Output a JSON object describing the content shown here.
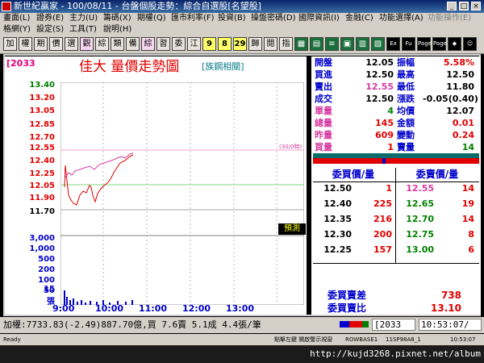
{
  "window": {
    "title": "新世紀贏家 - 100/08/11 - 台盤個股走勢：綜合自選股[名望股]"
  },
  "menu_row1": [
    "畫面(L)",
    "證券(E)",
    "主力(U)",
    "籌碼(X)",
    "期權(Q)",
    "匯市利率(F)",
    "投資(B)",
    "操盤密碼(D)",
    "國際資訊(I)",
    "金融(C)",
    "功能選擇(A)",
    "功能操作(E)"
  ],
  "menu_row2": [
    "格網(Y)",
    "設定(S)",
    "工具(T)",
    "說明(H)"
  ],
  "toolbar": [
    "加",
    "權",
    "期",
    "價",
    "選",
    "觀",
    "綜",
    "類",
    "備",
    "綜",
    "習",
    "委",
    "江",
    "9",
    "8",
    "29",
    "歸",
    "閱",
    "指",
    "",
    "",
    "",
    "",
    "Ex",
    "Fu",
    "Page",
    "Page"
  ],
  "stock": {
    "code": "[2033",
    "name": "佳大  量價走勢圖",
    "related": "[族鋼相關]"
  },
  "price_axis": [
    "13.40",
    "13.20",
    "13.05",
    "12.85",
    "12.70",
    "12.55",
    "12.40",
    "12.25",
    "12.05",
    "11.90",
    "11.70"
  ],
  "volume_axis": [
    "3,000",
    "1,000",
    "500",
    "200",
    "100",
    "50",
    "25",
    "15",
    "張"
  ],
  "time_axis": [
    "9:00",
    "10:00",
    "11:00",
    "12:00",
    "13:00"
  ],
  "annotation": "(30/0時)",
  "prediction_label": "預測",
  "quote": [
    {
      "l1": "開盤",
      "v1": "12.05",
      "l2": "振幅",
      "v2": "5.58%"
    },
    {
      "l1": "買進",
      "v1": "12.50",
      "l2": "最高",
      "v2": "12.50"
    },
    {
      "l1": "賣出",
      "v1": "12.55",
      "l2": "最低",
      "v2": "11.80"
    },
    {
      "l1": "成交",
      "v1": "12.50",
      "l2": "漲跌",
      "v2": "-0.05(0.40)"
    },
    {
      "l1": "單量",
      "v1": "4",
      "l2": "均價",
      "v2": "12.07"
    },
    {
      "l1": "總量",
      "v1": "145",
      "l2": "金額",
      "v2": "0.01"
    },
    {
      "l1": "昨量",
      "v1": "609",
      "l2": "變動",
      "v2": "0.24"
    },
    {
      "l1": "買量",
      "v1": "1",
      "l2": "賣量",
      "v2": "14"
    }
  ],
  "book_headers": {
    "bid": "委買價/量",
    "ask": "委賣價/量"
  },
  "book": [
    {
      "bp": "12.50",
      "bq": "1",
      "ap": "12.55",
      "aq": "14"
    },
    {
      "bp": "12.40",
      "bq": "225",
      "ap": "12.65",
      "aq": "19"
    },
    {
      "bp": "12.35",
      "bq": "216",
      "ap": "12.70",
      "aq": "14"
    },
    {
      "bp": "12.30",
      "bq": "200",
      "ap": "12.75",
      "aq": "8"
    },
    {
      "bp": "12.25",
      "bq": "157",
      "ap": "13.00",
      "aq": "6"
    }
  ],
  "summary": [
    {
      "label": "委買賣差",
      "value": "738"
    },
    {
      "label": "委買賣比",
      "value": "13.10"
    }
  ],
  "ticker": "加權:7733.83(-2.49)887.70億,買 7.6賣 5.1成 4.4張/筆",
  "status_code": "[2033",
  "clock": "10:53:07/",
  "win_status": [
    "Ready",
    "點擊左鍵 開啟警示視窗",
    "ROWBASE1",
    "11SP98A8_1",
    "10:53:07"
  ],
  "watermark": "http://kujd3268.pixnet.net/album",
  "colors": {
    "up": "#e00000",
    "down": "#008000",
    "label": "#0000cc",
    "background": "#000000"
  }
}
